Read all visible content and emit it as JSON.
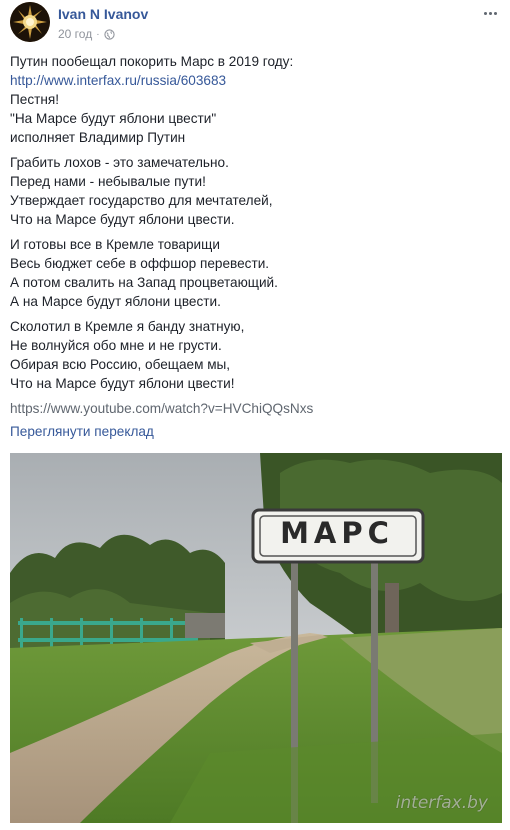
{
  "post": {
    "author": "Ivan N Ivanov",
    "time": "20 год",
    "separator": "·",
    "lines": [
      "Путин пообещал покорить Марс в 2019 году:",
      "http://www.interfax.ru/russia/603683",
      "Пестня!",
      "\"На Марсе будут яблони цвести\"",
      "исполняет Владимир Путин",
      "Грабить лохов - это замечательно.",
      "Перед нами - небывалые пути!",
      "Утверждает государство для мечтателей,",
      "Что на Марсе будут яблони цвести.",
      "И готовы все в Кремле товарищи",
      "Весь бюджет себе в оффшор перевести.",
      "А потом свалить на Запад процветающий.",
      "А на Марсе будут яблони цвести.",
      "Сколотил в Кремле я банду знатную,",
      "Не волнуйся обо мне и не грусти.",
      "Обирая всю Россию, обещаем мы,",
      "Что на Марсе будут яблони цвести!",
      "https://www.youtube.com/watch?v=HVChiQQsNxs"
    ],
    "translate_label": "Переглянути переклад",
    "photo": {
      "sign_text": "МАРС",
      "watermark": "interfax.by"
    },
    "icons": {
      "globe": "globe-icon",
      "more": "more-options-icon",
      "avatar": "avatar-image"
    },
    "colors": {
      "link": "#365899",
      "meta": "#90949c",
      "text": "#1d2129"
    }
  }
}
